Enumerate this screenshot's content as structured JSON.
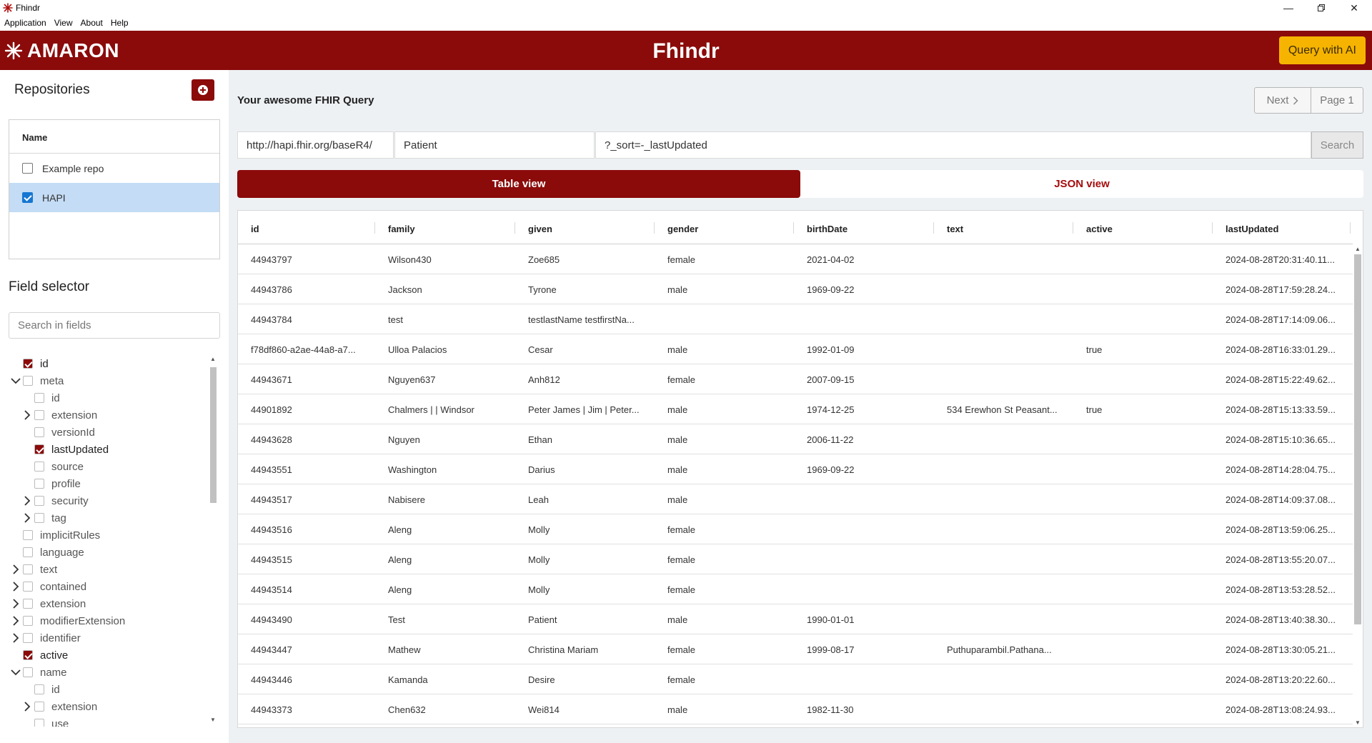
{
  "window": {
    "title": "Fhindr"
  },
  "menubar": [
    "Application",
    "View",
    "About",
    "Help"
  ],
  "header": {
    "logo_text": "AMARON",
    "app_title": "Fhindr",
    "ai_button": "Query with AI",
    "brand_color": "#8b0a0a",
    "ai_color": "#f6b400"
  },
  "repositories": {
    "title": "Repositories",
    "column_header": "Name",
    "items": [
      {
        "label": "Example repo",
        "checked": false
      },
      {
        "label": "HAPI",
        "checked": true
      }
    ]
  },
  "field_selector": {
    "title": "Field selector",
    "search_placeholder": "Search in fields",
    "tree": [
      {
        "label": "id",
        "depth": 0,
        "expander": "none",
        "checked": true
      },
      {
        "label": "meta",
        "depth": 0,
        "expander": "open",
        "checked": false
      },
      {
        "label": "id",
        "depth": 1,
        "expander": "none",
        "checked": false
      },
      {
        "label": "extension",
        "depth": 1,
        "expander": "closed",
        "checked": false
      },
      {
        "label": "versionId",
        "depth": 1,
        "expander": "none",
        "checked": false
      },
      {
        "label": "lastUpdated",
        "depth": 1,
        "expander": "none",
        "checked": true
      },
      {
        "label": "source",
        "depth": 1,
        "expander": "none",
        "checked": false
      },
      {
        "label": "profile",
        "depth": 1,
        "expander": "none",
        "checked": false
      },
      {
        "label": "security",
        "depth": 1,
        "expander": "closed",
        "checked": false
      },
      {
        "label": "tag",
        "depth": 1,
        "expander": "closed",
        "checked": false
      },
      {
        "label": "implicitRules",
        "depth": 0,
        "expander": "none",
        "checked": false
      },
      {
        "label": "language",
        "depth": 0,
        "expander": "none",
        "checked": false
      },
      {
        "label": "text",
        "depth": 0,
        "expander": "closed",
        "checked": false
      },
      {
        "label": "contained",
        "depth": 0,
        "expander": "closed",
        "checked": false
      },
      {
        "label": "extension",
        "depth": 0,
        "expander": "closed",
        "checked": false
      },
      {
        "label": "modifierExtension",
        "depth": 0,
        "expander": "closed",
        "checked": false
      },
      {
        "label": "identifier",
        "depth": 0,
        "expander": "closed",
        "checked": false
      },
      {
        "label": "active",
        "depth": 0,
        "expander": "none",
        "checked": true
      },
      {
        "label": "name",
        "depth": 0,
        "expander": "open",
        "checked": false
      },
      {
        "label": "id",
        "depth": 1,
        "expander": "none",
        "checked": false
      },
      {
        "label": "extension",
        "depth": 1,
        "expander": "closed",
        "checked": false
      },
      {
        "label": "use",
        "depth": 1,
        "expander": "none",
        "checked": false
      }
    ]
  },
  "query": {
    "title": "Your awesome FHIR Query",
    "pager": {
      "next_label": "Next",
      "page_label": "Page 1"
    },
    "base_url": "http://hapi.fhir.org/baseR4/",
    "resource": "Patient",
    "params": "?_sort=-_lastUpdated",
    "search_button": "Search",
    "tabs": {
      "table": "Table view",
      "json": "JSON view"
    }
  },
  "table": {
    "columns": [
      "id",
      "family",
      "given",
      "gender",
      "birthDate",
      "text",
      "active",
      "lastUpdated"
    ],
    "rows": [
      [
        "44943797",
        "Wilson430",
        "Zoe685",
        "female",
        "2021-04-02",
        "",
        "",
        "2024-08-28T20:31:40.11..."
      ],
      [
        "44943786",
        "Jackson",
        "Tyrone",
        "male",
        "1969-09-22",
        "",
        "",
        "2024-08-28T17:59:28.24..."
      ],
      [
        "44943784",
        "test",
        "testlastName testfirstNa...",
        "",
        "",
        "",
        "",
        "2024-08-28T17:14:09.06..."
      ],
      [
        "f78df860-a2ae-44a8-a7...",
        "Ulloa Palacios",
        "Cesar",
        "male",
        "1992-01-09",
        "",
        "true",
        "2024-08-28T16:33:01.29..."
      ],
      [
        "44943671",
        "Nguyen637",
        "Anh812",
        "female",
        "2007-09-15",
        "",
        "",
        "2024-08-28T15:22:49.62..."
      ],
      [
        "44901892",
        "Chalmers | | Windsor",
        "Peter James | Jim | Peter...",
        "male",
        "1974-12-25",
        "534 Erewhon St Peasant...",
        "true",
        "2024-08-28T15:13:33.59..."
      ],
      [
        "44943628",
        "Nguyen",
        "Ethan",
        "male",
        "2006-11-22",
        "",
        "",
        "2024-08-28T15:10:36.65..."
      ],
      [
        "44943551",
        "Washington",
        "Darius",
        "male",
        "1969-09-22",
        "",
        "",
        "2024-08-28T14:28:04.75..."
      ],
      [
        "44943517",
        "Nabisere",
        "Leah",
        "male",
        "",
        "",
        "",
        "2024-08-28T14:09:37.08..."
      ],
      [
        "44943516",
        "Aleng",
        "Molly",
        "female",
        "",
        "",
        "",
        "2024-08-28T13:59:06.25..."
      ],
      [
        "44943515",
        "Aleng",
        "Molly",
        "female",
        "",
        "",
        "",
        "2024-08-28T13:55:20.07..."
      ],
      [
        "44943514",
        "Aleng",
        "Molly",
        "female",
        "",
        "",
        "",
        "2024-08-28T13:53:28.52..."
      ],
      [
        "44943490",
        "Test",
        "Patient",
        "male",
        "1990-01-01",
        "",
        "",
        "2024-08-28T13:40:38.30..."
      ],
      [
        "44943447",
        "Mathew",
        "Christina Mariam",
        "female",
        "1999-08-17",
        "Puthuparambil.Pathana...",
        "",
        "2024-08-28T13:30:05.21..."
      ],
      [
        "44943446",
        "Kamanda",
        "Desire",
        "female",
        "",
        "",
        "",
        "2024-08-28T13:20:22.60..."
      ],
      [
        "44943373",
        "Chen632",
        "Wei814",
        "male",
        "1982-11-30",
        "",
        "",
        "2024-08-28T13:08:24.93..."
      ]
    ]
  }
}
